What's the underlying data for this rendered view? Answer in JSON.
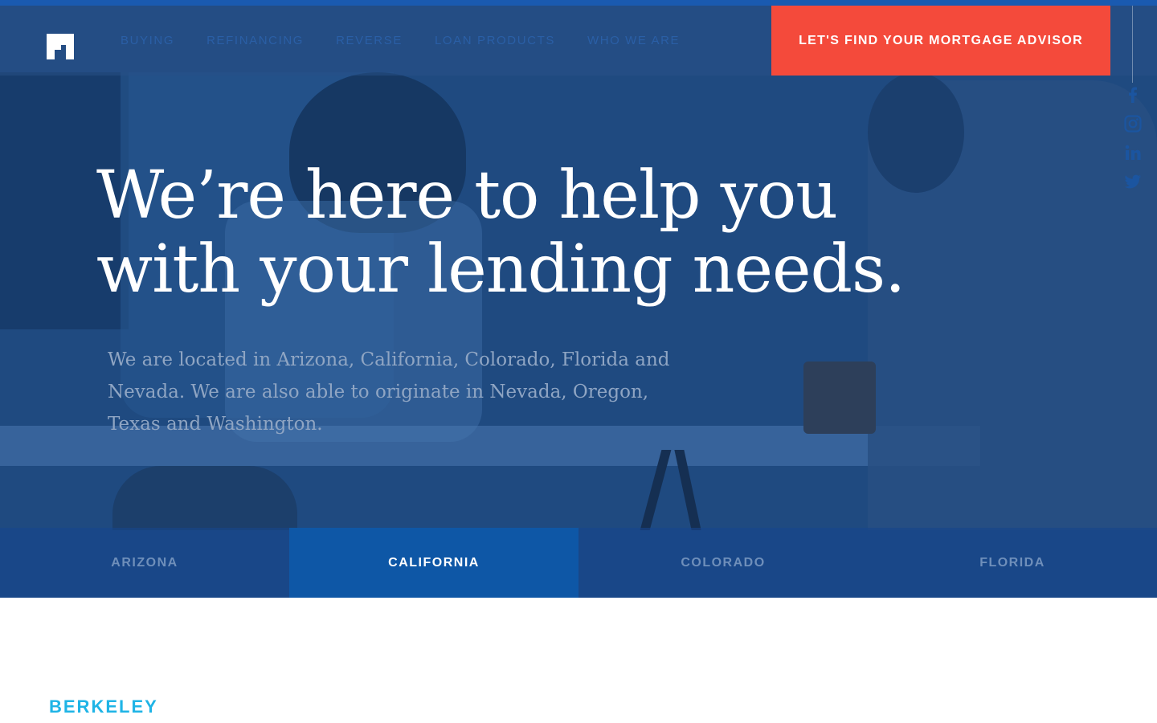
{
  "colors": {
    "hero_overlay": "#1f4a80",
    "cta": "#f44a3b",
    "active_tab": "#0e57a6",
    "nav_text": "#2a5fa6",
    "city_text": "#1fb4e6"
  },
  "header": {
    "logo_icon": "house-logo-icon",
    "nav": [
      {
        "label": "BUYING"
      },
      {
        "label": "REFINANCING"
      },
      {
        "label": "REVERSE"
      },
      {
        "label": "LOAN PRODUCTS"
      },
      {
        "label": "WHO WE ARE"
      }
    ],
    "cta_label": "LET'S FIND YOUR MORTGAGE ADVISOR"
  },
  "social": [
    "facebook-icon",
    "instagram-icon",
    "linkedin-icon",
    "twitter-icon"
  ],
  "hero": {
    "headline_line1": "We’re here to help you",
    "headline_line2": "with your lending needs.",
    "subtext": "We are located in Arizona, California, Colorado, Florida and Nevada. We are also able to originate in Nevada, Oregon, Texas and Washington."
  },
  "tabs": [
    {
      "label": "ARIZONA",
      "active": false
    },
    {
      "label": "CALIFORNIA",
      "active": true
    },
    {
      "label": "COLORADO",
      "active": false
    },
    {
      "label": "FLORIDA",
      "active": false
    }
  ],
  "section": {
    "city": "BERKELEY"
  }
}
